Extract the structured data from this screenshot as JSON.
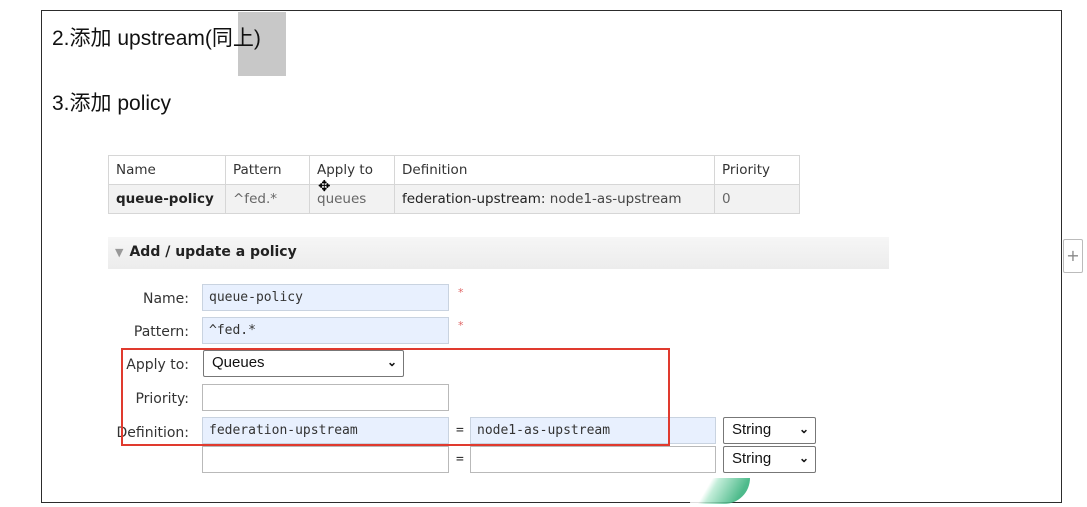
{
  "doc": {
    "step2": "2.添加 upstream(同上)",
    "step3": "3.添加 policy"
  },
  "policy_table": {
    "headers": [
      "Name",
      "Pattern",
      "Apply to",
      "Definition",
      "Priority"
    ],
    "rows": [
      {
        "name": "queue-policy",
        "pattern": "^fed.*",
        "apply_to": "queues",
        "definition_key": "federation-upstream:",
        "definition_value": "node1-as-upstream",
        "priority": "0"
      }
    ]
  },
  "form": {
    "section_title": "Add / update a policy",
    "name_label": "Name:",
    "name_value": "queue-policy",
    "pattern_label": "Pattern:",
    "pattern_value": "^fed.*",
    "apply_label": "Apply to:",
    "apply_value": "Queues",
    "priority_label": "Priority:",
    "priority_value": "",
    "definition_label": "Definition:",
    "definition_rows": [
      {
        "key": "federation-upstream",
        "value": "node1-as-upstream",
        "type": "String"
      },
      {
        "key": "",
        "value": "",
        "type": "String"
      }
    ],
    "required_mark": "*",
    "eq": "="
  },
  "colors": {
    "highlight_box": "#e03a2e",
    "input_fill": "#e8f0fe",
    "table_row_bg": "#f2f2f2"
  },
  "icons": {
    "collapse": "triangle-down-icon",
    "expand_side": "plus-icon",
    "select_arrow": "chevron-down-icon"
  }
}
